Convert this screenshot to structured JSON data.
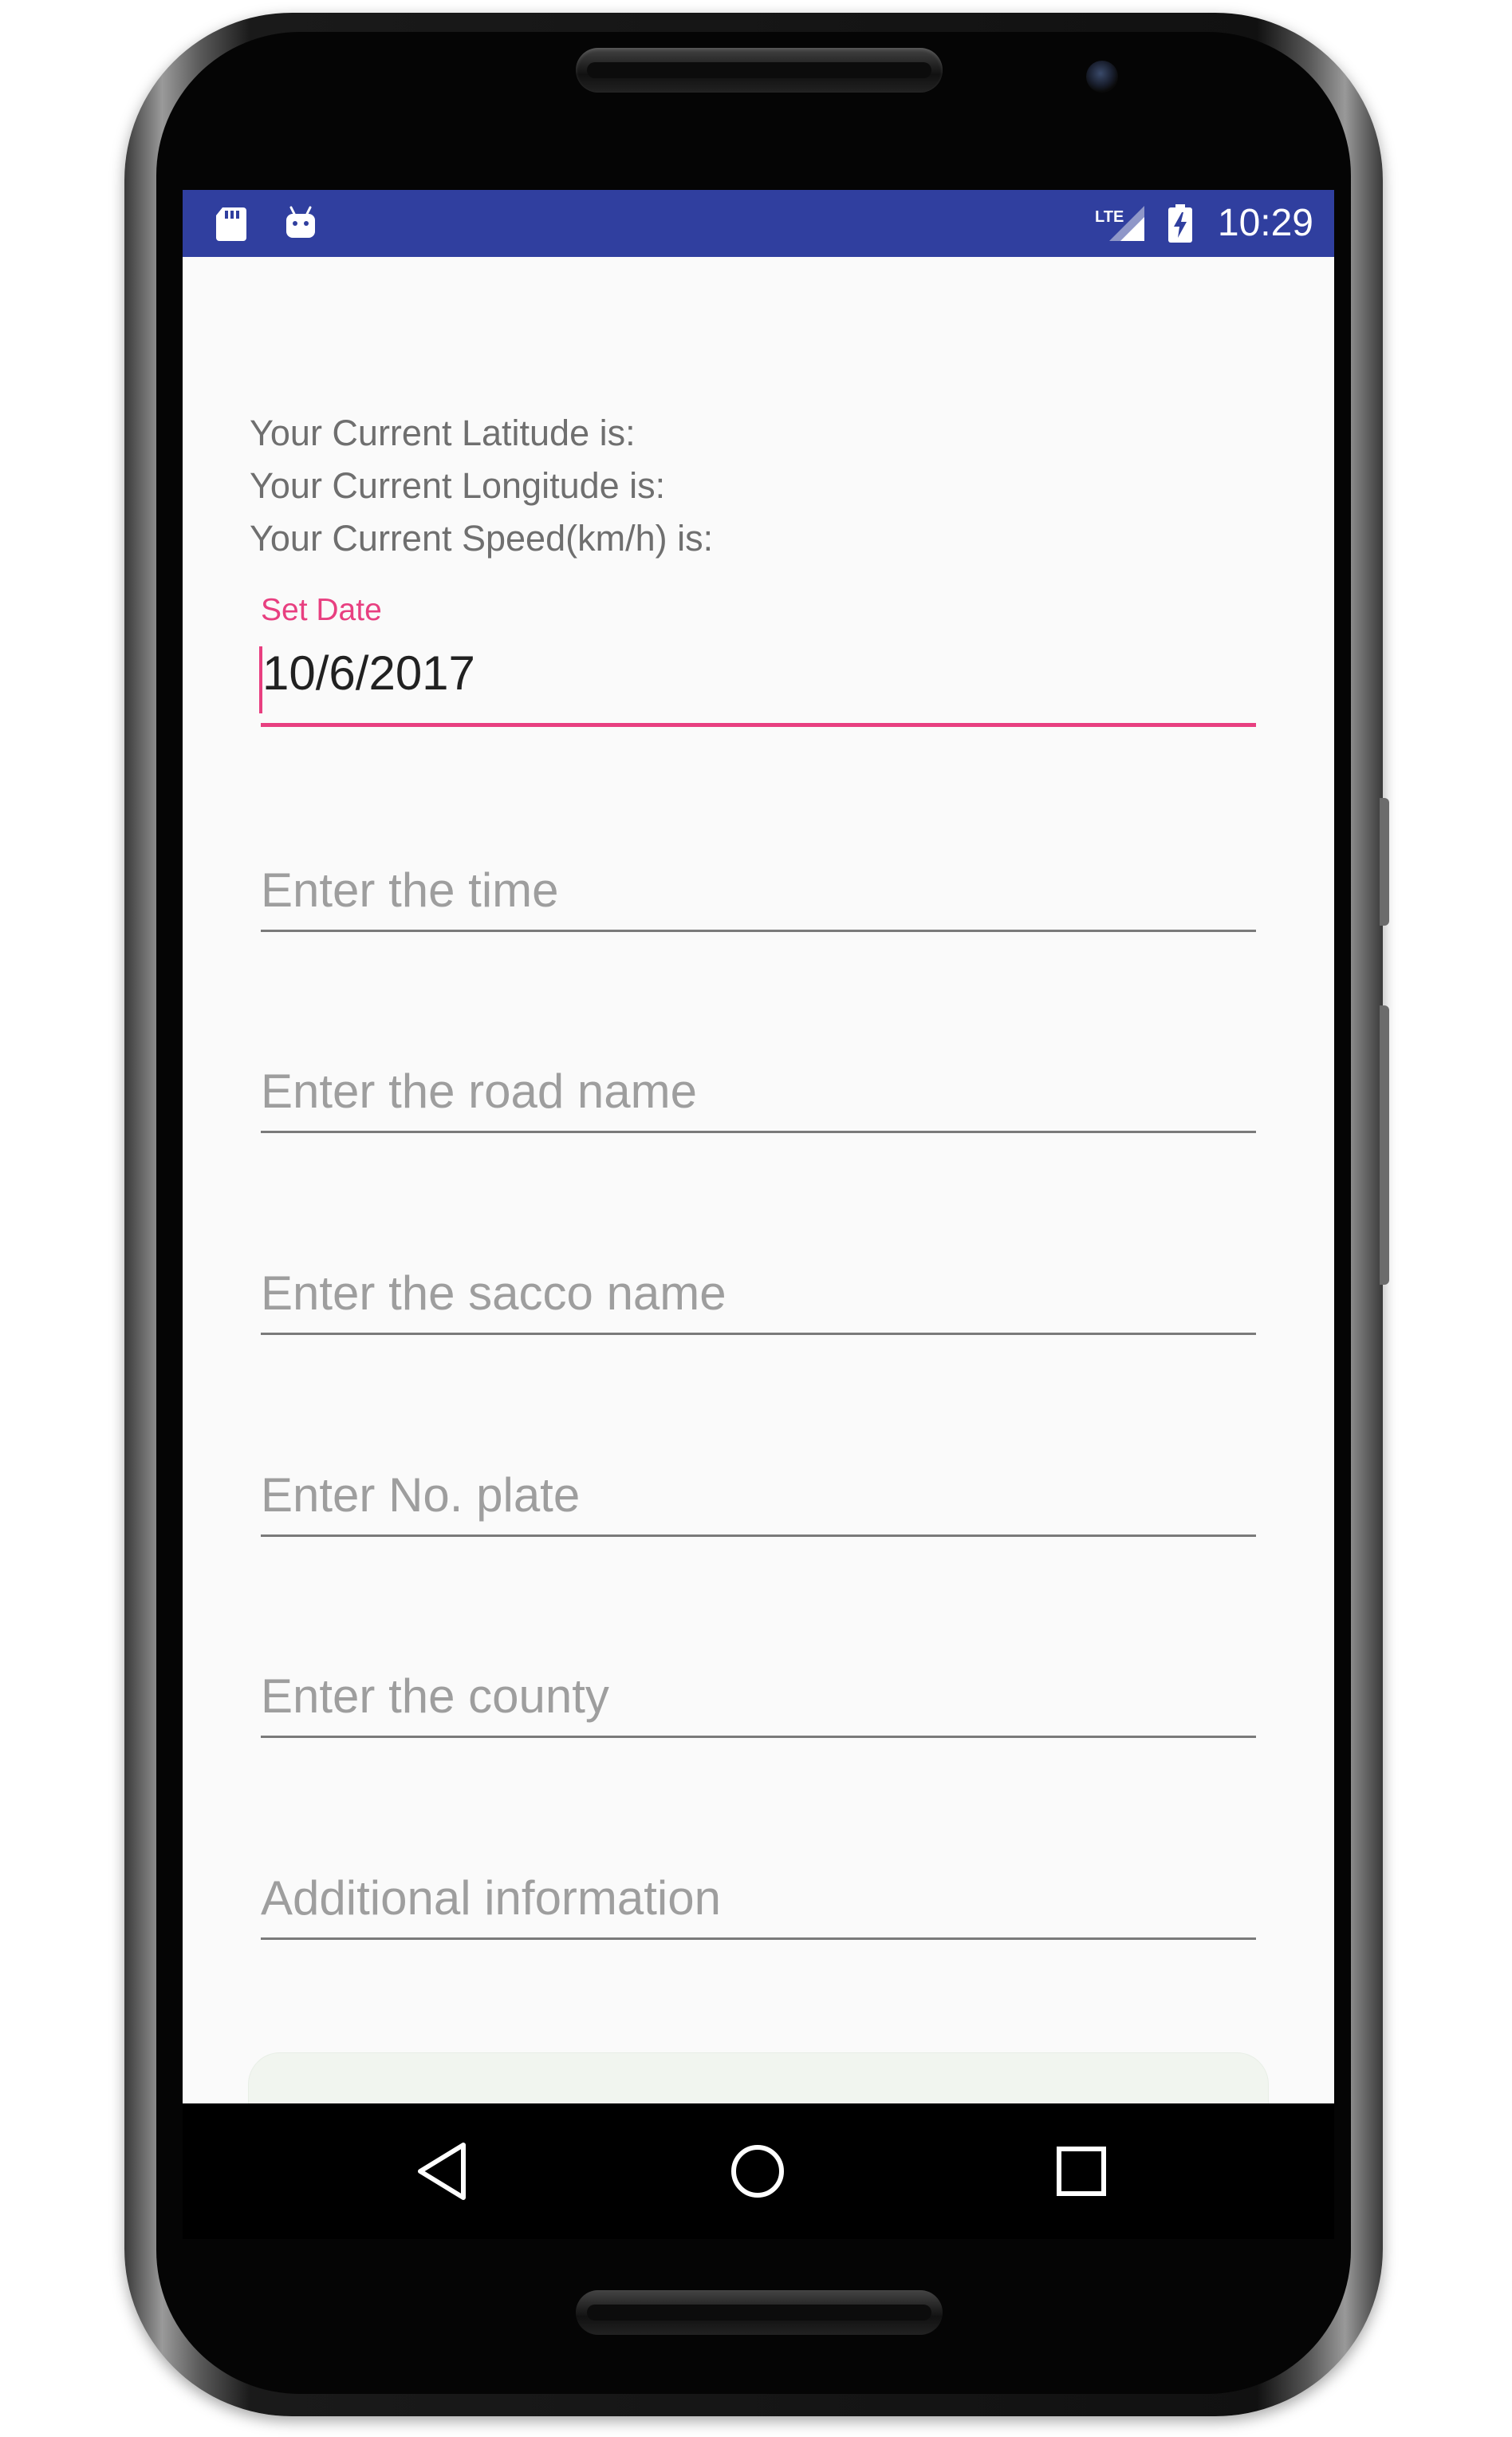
{
  "status_bar": {
    "time": "10:29",
    "network": "LTE",
    "color": "#303f9f",
    "icons": [
      "sd-card-icon",
      "android-icon",
      "lte-signal-icon",
      "battery-charging-icon"
    ]
  },
  "location_info": {
    "latitude_label": "Your Current Latitude is:",
    "longitude_label": "Your Current Longitude is:",
    "speed_label": "Your Current Speed(km/h) is:"
  },
  "date_field": {
    "label": "Set Date",
    "value": "10/6/2017",
    "accent_color": "#e83f80"
  },
  "fields": {
    "time_hint": "Enter the time",
    "road_hint": "Enter the road name",
    "sacco_hint": "Enter the sacco name",
    "plate_hint": "Enter No. plate",
    "county_hint": "Enter the county",
    "additional_hint": "Additional information"
  },
  "nav_bar": {
    "icons": [
      "back-icon",
      "home-icon",
      "recents-icon"
    ]
  }
}
